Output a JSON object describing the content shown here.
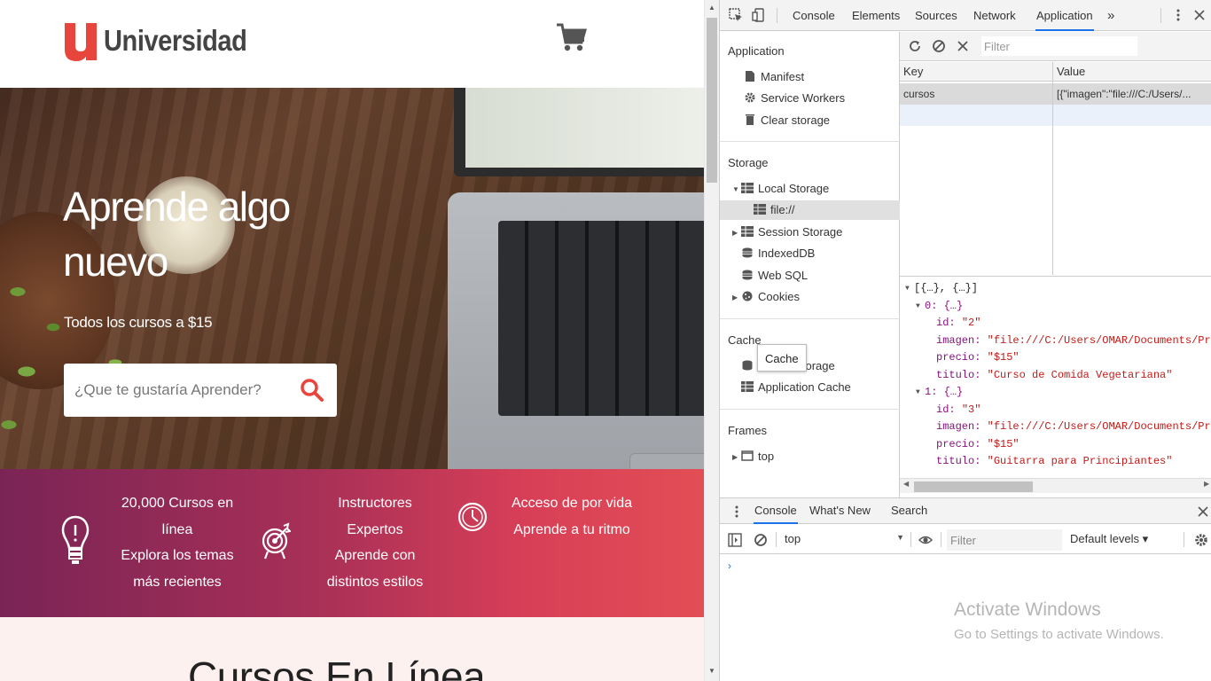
{
  "site": {
    "logo_text": "Universidad",
    "hero_title": "Aprende algo nuevo",
    "hero_subtitle": "Todos los cursos a $15",
    "search_placeholder": "¿Que te gustaría Aprender?",
    "features": [
      {
        "icon": "lightbulb-icon",
        "lines": [
          "20,000 Cursos en",
          "línea",
          "Explora los temas",
          "más recientes"
        ]
      },
      {
        "icon": "target-icon",
        "lines": [
          "Instructores",
          "Expertos",
          "Aprende con",
          "distintos estilos"
        ]
      },
      {
        "icon": "clock-icon",
        "lines": [
          "Acceso de por vida",
          "Aprende a tu ritmo"
        ]
      }
    ],
    "courses_heading": "Cursos En Línea",
    "brand_color": "#e8453c"
  },
  "devtools": {
    "tabs": [
      "Console",
      "Elements",
      "Sources",
      "Network",
      "Application"
    ],
    "active_tab": "Application",
    "more_tabs_glyph": "»",
    "sidebar": {
      "application_heading": "Application",
      "application_items": [
        "Manifest",
        "Service Workers",
        "Clear storage"
      ],
      "storage_heading": "Storage",
      "local_storage": "Local Storage",
      "local_storage_origin": "file://",
      "session_storage": "Session Storage",
      "indexeddb": "IndexedDB",
      "websql": "Web SQL",
      "cookies": "Cookies",
      "cache_heading": "Cache",
      "cache_storage": "Cache Storage",
      "application_cache": "Application Cache",
      "frames_heading": "Frames",
      "frames_top": "top"
    },
    "tooltip": "Cache",
    "filter_placeholder": "Filter",
    "table": {
      "key_header": "Key",
      "value_header": "Value",
      "rows": [
        {
          "key": "cursos",
          "value": "[{\"imagen\":\"file:///C:/Users/..."
        }
      ]
    },
    "preview": {
      "root": "[{…}, {…}]",
      "items": [
        {
          "index": "0: {…}",
          "id": "\"2\"",
          "imagen": "\"file:///C:/Users/OMAR/Documents/Practi",
          "precio": "\"$15\"",
          "titulo": "\"Curso de Comida Vegetariana\""
        },
        {
          "index": "1: {…}",
          "id": "\"3\"",
          "imagen": "\"file:///C:/Users/OMAR/Documents/Practi",
          "precio": "\"$15\"",
          "titulo": "\"Guitarra para Principiantes\""
        }
      ],
      "labels": {
        "id": "id:",
        "imagen": "imagen:",
        "precio": "precio:",
        "titulo": "titulo:"
      }
    },
    "drawer": {
      "tabs": [
        "Console",
        "What's New",
        "Search"
      ],
      "context": "top",
      "filter_placeholder": "Filter",
      "levels": "Default levels ▾",
      "prompt": "›"
    }
  },
  "watermark": {
    "title": "Activate Windows",
    "subtitle": "Go to Settings to activate Windows."
  }
}
